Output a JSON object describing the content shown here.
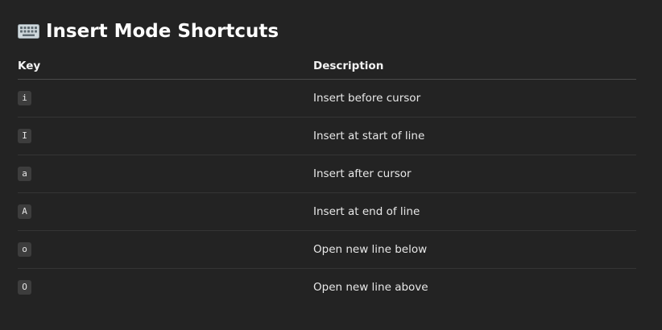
{
  "header": {
    "icon": "keyboard-icon",
    "title": "Insert Mode Shortcuts"
  },
  "table": {
    "columns": [
      "Key",
      "Description"
    ],
    "rows": [
      {
        "key": "i",
        "description": "Insert before cursor"
      },
      {
        "key": "I",
        "description": "Insert at start of line"
      },
      {
        "key": "a",
        "description": "Insert after cursor"
      },
      {
        "key": "A",
        "description": "Insert at end of line"
      },
      {
        "key": "o",
        "description": "Open new line below"
      },
      {
        "key": "O",
        "description": "Open new line above"
      }
    ]
  },
  "colors": {
    "background": "#232323",
    "text": "#f0f0f0",
    "kbd_background": "#3d3d3d",
    "divider": "#4a4a4a"
  }
}
